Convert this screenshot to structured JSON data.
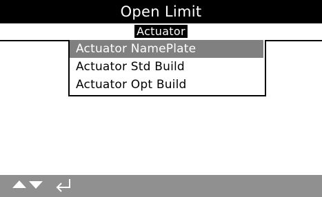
{
  "header": {
    "title": "Open Limit"
  },
  "breadcrumb": {
    "label": "Actuator"
  },
  "menu": {
    "items": [
      {
        "label": "Actuator NamePlate",
        "selected": true
      },
      {
        "label": "Actuator Std Build",
        "selected": false
      },
      {
        "label": "Actuator Opt Build",
        "selected": false
      }
    ]
  },
  "footer": {
    "icons": [
      "up-arrow-icon",
      "down-arrow-icon",
      "enter-return-icon"
    ]
  },
  "colors": {
    "title_background": "#000000",
    "selection_background": "#808080",
    "footer_background": "#909090",
    "text": "#000000",
    "inverse_text": "#ffffff"
  }
}
